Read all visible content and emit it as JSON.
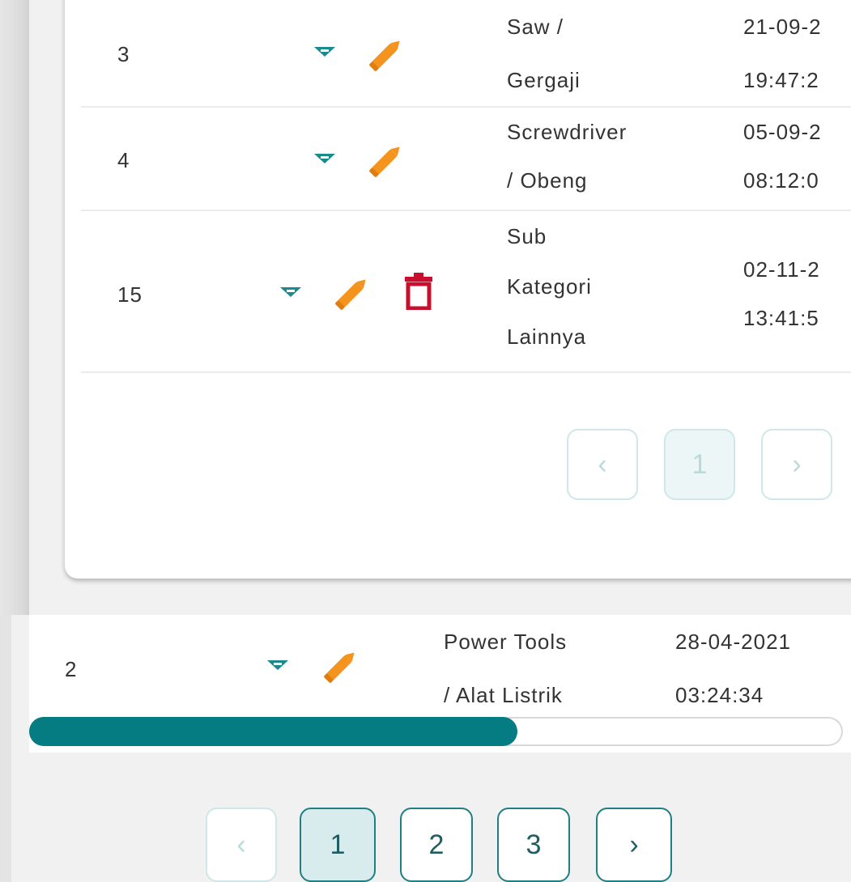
{
  "inner_table": {
    "rows": [
      {
        "id": "3",
        "name_lines": [
          "Saw /",
          "Gergaji"
        ],
        "date_lines": [
          "21-09-2",
          "19:47:2"
        ],
        "deletable": false
      },
      {
        "id": "4",
        "name_lines": [
          "Screwdriver",
          "/ Obeng"
        ],
        "date_lines": [
          "05-09-2",
          "08:12:0"
        ],
        "deletable": false
      },
      {
        "id": "15",
        "name_lines": [
          "Sub",
          "Kategori",
          "Lainnya"
        ],
        "date_lines": [
          "02-11-2",
          "13:41:5"
        ],
        "deletable": true
      }
    ],
    "pagination": {
      "prev": "‹",
      "pages": [
        "1"
      ],
      "current": "1",
      "next": "›"
    }
  },
  "outer_table": {
    "row": {
      "id": "2",
      "name_lines": [
        "Power Tools",
        "/ Alat Listrik"
      ],
      "date_lines": [
        "28-04-2021",
        "03:24:34"
      ]
    },
    "horizontal_scroll_fraction": 0.6,
    "pagination": {
      "prev": "‹",
      "pages": [
        "1",
        "2",
        "3"
      ],
      "current": "1",
      "next": "›"
    }
  },
  "icons": {
    "expand": "caret-down-icon",
    "edit": "pencil-icon",
    "delete": "trash-icon"
  },
  "colors": {
    "teal": "#1a8a8e",
    "edit_orange": "#f4931e",
    "delete_red": "#c8102e",
    "scroll_thumb": "#057b82"
  }
}
